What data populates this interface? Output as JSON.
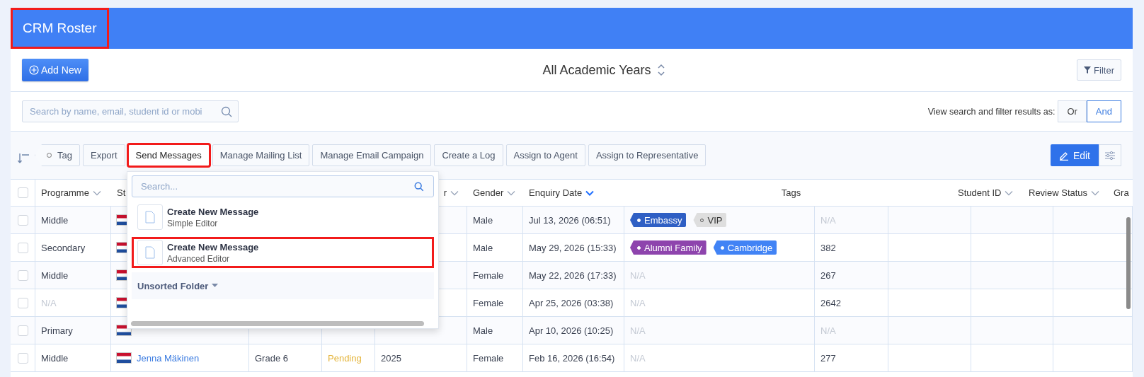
{
  "window": {
    "title": "CRM Roster",
    "highlighted": true
  },
  "add_button": "Add New",
  "year_selector": "All Academic Years",
  "filter_button": "Filter",
  "search": {
    "placeholder": "Search by name, email, student id or mobi"
  },
  "result_mode": {
    "label": "View search and filter results as:",
    "options": [
      {
        "label": "Or",
        "selected": false
      },
      {
        "label": "And",
        "selected": true
      }
    ]
  },
  "actions": [
    {
      "label": "Tag",
      "kind": "tag",
      "highlighted": false
    },
    {
      "label": "Export",
      "kind": "plain",
      "highlighted": false
    },
    {
      "label": "Send Messages",
      "kind": "plain",
      "highlighted": true
    },
    {
      "label": "Manage Mailing List",
      "kind": "plain",
      "highlighted": false
    },
    {
      "label": "Manage Email Campaign",
      "kind": "plain",
      "highlighted": false
    },
    {
      "label": "Create a Log",
      "kind": "plain",
      "highlighted": false
    },
    {
      "label": "Assign to Agent",
      "kind": "plain",
      "highlighted": false
    },
    {
      "label": "Assign to Representative",
      "kind": "plain",
      "highlighted": false
    }
  ],
  "edit_button": "Edit",
  "table": {
    "header_checked": false,
    "columns": [
      {
        "label": "Programme",
        "caret": true,
        "sorted": false
      },
      {
        "label": "St",
        "caret": false
      },
      {
        "label": "r",
        "caret": true,
        "sorted": false
      },
      {
        "label": "Gender",
        "caret": true,
        "sorted": false
      },
      {
        "label": "Enquiry Date",
        "caret": true,
        "sorted": true
      },
      {
        "label": "Tags",
        "caret": false
      },
      {
        "label": "Student ID",
        "caret": true,
        "sorted": false
      },
      {
        "label": "Review Status",
        "caret": true,
        "sorted": false
      },
      {
        "label": "Gra",
        "caret": false
      }
    ],
    "rows": [
      {
        "checked": false,
        "programme": {
          "text": "Middle",
          "muted": false
        },
        "gender": "Male",
        "enquiry_date": "Jul 13, 2026 (06:51)",
        "tags": [
          {
            "label": "Embassy",
            "color": "#2f5fc4"
          },
          {
            "label": "VIP",
            "color": "#dedede"
          }
        ],
        "column_10": {
          "text": "N/A",
          "muted": true
        }
      },
      {
        "checked": false,
        "programme": {
          "text": "Secondary",
          "muted": false
        },
        "gender": "Male",
        "enquiry_date": "May 29, 2026 (15:33)",
        "tags": [
          {
            "label": "Alumni Family",
            "color": "#8e44ad"
          },
          {
            "label": "Cambridge",
            "color": "#4183f5"
          }
        ],
        "column_10": {
          "text": "382",
          "muted": false
        }
      },
      {
        "checked": false,
        "programme": {
          "text": "Middle",
          "muted": false
        },
        "gender": "Female",
        "enquiry_date": "May 22, 2026 (17:33)",
        "tags_empty": "N/A",
        "column_10": {
          "text": "267",
          "muted": false
        }
      },
      {
        "checked": false,
        "programme": {
          "text": "N/A",
          "muted": true
        },
        "gender": "Female",
        "enquiry_date": "Apr 25, 2026 (03:38)",
        "tags_empty": "N/A",
        "column_10": {
          "text": "2642",
          "muted": false
        }
      },
      {
        "checked": false,
        "programme": {
          "text": "Primary",
          "muted": false
        },
        "gender": "Male",
        "enquiry_date": "Apr 10, 2026 (10:25)",
        "tags_empty": "N/A",
        "column_10": {
          "text": "N/A",
          "muted": true
        }
      },
      {
        "checked": false,
        "programme": {
          "text": "Middle",
          "muted": false
        },
        "student": "Jenna Mäkinen",
        "grade": "Grade 6",
        "status": "Pending",
        "year": "2025",
        "gender": "Female",
        "enquiry_date": "Feb 16, 2026 (16:54)",
        "tags_empty": "N/A",
        "column_10": {
          "text": "277",
          "muted": false
        }
      }
    ]
  },
  "message_menu": {
    "search_placeholder": "Search...",
    "items": [
      {
        "title": "Create New Message",
        "subtitle": "Simple Editor",
        "highlighted": false
      },
      {
        "title": "Create New Message",
        "subtitle": "Advanced Editor",
        "highlighted": true
      }
    ],
    "folder": "Unsorted Folder"
  }
}
